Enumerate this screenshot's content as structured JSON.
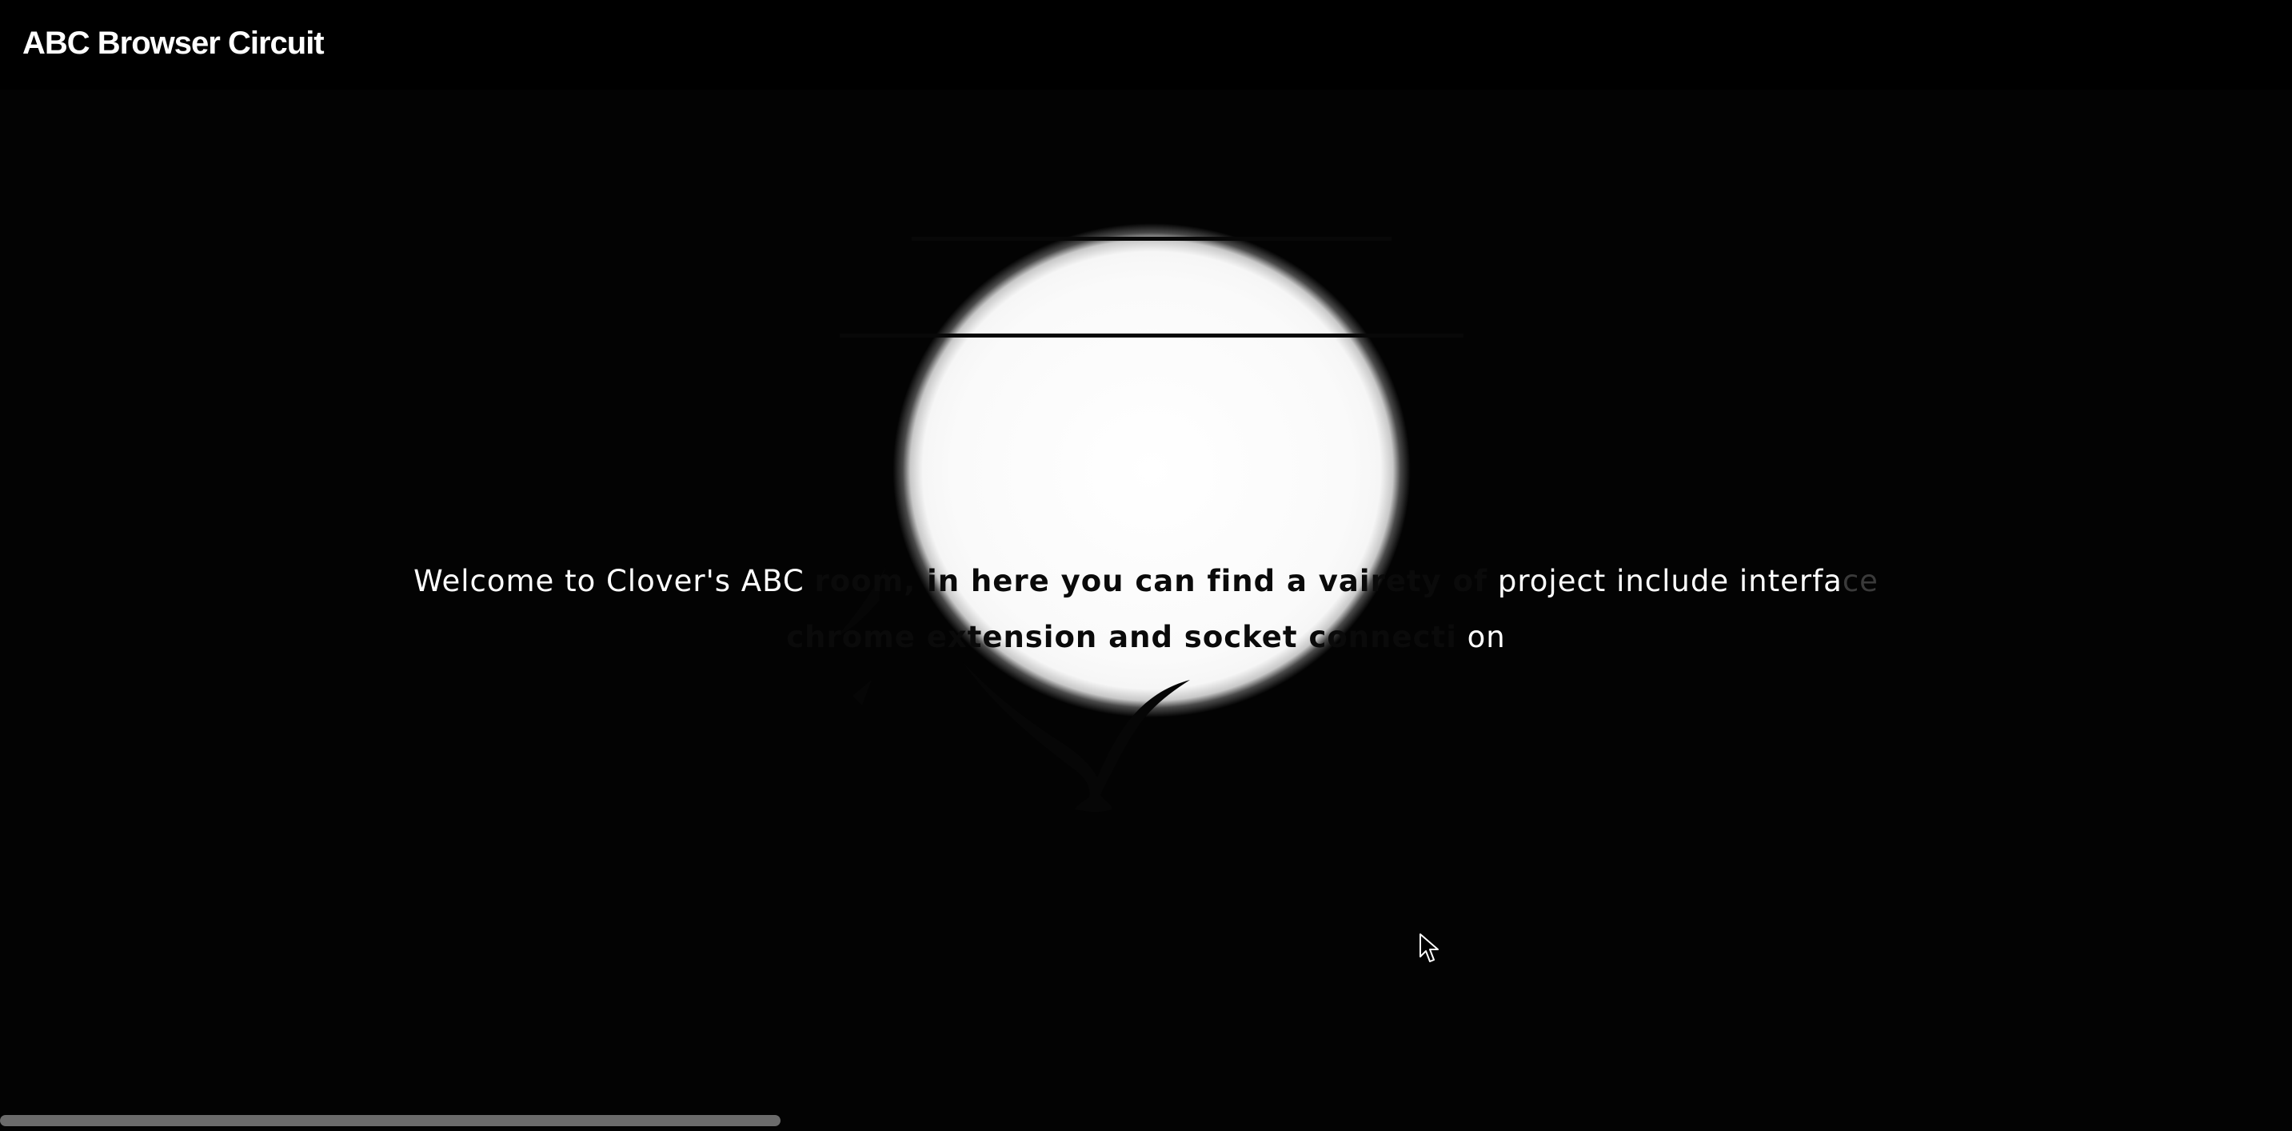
{
  "header": {
    "title": "ABC Browser Circuit"
  },
  "main": {
    "welcome_line1_a": "Welcome to Clover's ABC ",
    "welcome_line1_b": "room, in here you can find a vairety of",
    "welcome_line1_c": " project include interfa",
    "welcome_line1_d": "ce",
    "welcome_line2_a": "chrome extension and socket connecti",
    "welcome_line2_b": " on"
  },
  "icons": {
    "bird": "bird-silhouette-icon",
    "cursor": "mouse-pointer-icon"
  },
  "colors": {
    "background": "#030303",
    "spotlight": "#ffffff",
    "text_light": "#ffffff",
    "text_dark": "#0a0a0a",
    "scrollbar": "#6b6b6b"
  }
}
